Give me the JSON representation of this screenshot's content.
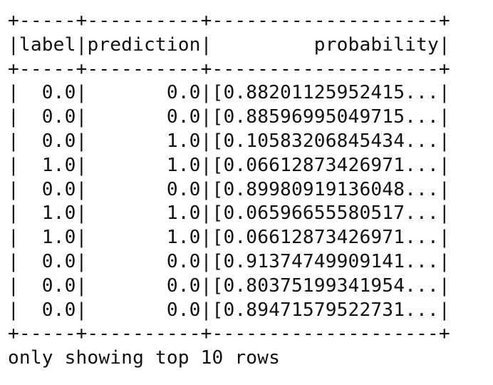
{
  "table": {
    "border_top": "+-----+----------+--------------------+",
    "header": {
      "label": "label",
      "prediction": "prediction",
      "probability": "probability"
    },
    "border_mid": "+-----+----------+--------------------+",
    "rows": [
      {
        "label": "0.0",
        "prediction": "0.0",
        "probability": "[0.88201125952415..."
      },
      {
        "label": "0.0",
        "prediction": "0.0",
        "probability": "[0.88596995049715..."
      },
      {
        "label": "0.0",
        "prediction": "1.0",
        "probability": "[0.10583206845434..."
      },
      {
        "label": "1.0",
        "prediction": "1.0",
        "probability": "[0.06612873426971..."
      },
      {
        "label": "0.0",
        "prediction": "0.0",
        "probability": "[0.89980919136048..."
      },
      {
        "label": "1.0",
        "prediction": "1.0",
        "probability": "[0.06596655580517..."
      },
      {
        "label": "1.0",
        "prediction": "1.0",
        "probability": "[0.06612873426971..."
      },
      {
        "label": "0.0",
        "prediction": "0.0",
        "probability": "[0.91374749909141..."
      },
      {
        "label": "0.0",
        "prediction": "0.0",
        "probability": "[0.80375199341954..."
      },
      {
        "label": "0.0",
        "prediction": "0.0",
        "probability": "[0.89471579522731..."
      }
    ],
    "border_bottom": "+-----+----------+--------------------+"
  },
  "footer": "only showing top 10 rows"
}
